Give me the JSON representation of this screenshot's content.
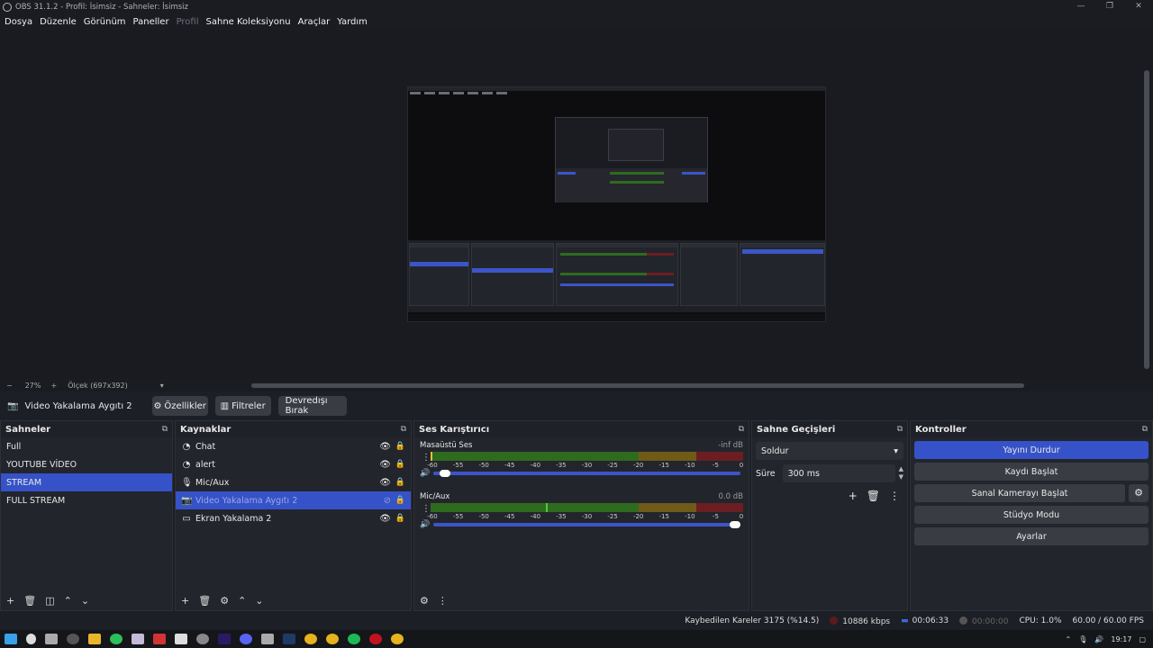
{
  "window": {
    "title": "OBS 31.1.2 - Profil: İsimsiz - Sahneler: İsimsiz"
  },
  "menu": {
    "items": [
      "Dosya",
      "Düzenle",
      "Görünüm",
      "Paneller",
      "Profil",
      "Sahne Koleksiyonu",
      "Araçlar",
      "Yardım"
    ],
    "disabled": [
      "Profil"
    ]
  },
  "zoom": {
    "minus": "−",
    "percent": "27%",
    "plus": "+",
    "scale": "Ölçek (697x392)",
    "dropdown": "▾"
  },
  "source_bar": {
    "name": "Video Yakalama Aygıtı 2",
    "properties": "Özellikler",
    "filters": "Filtreler",
    "deactivate": "Devredışı Bırak"
  },
  "scenes": {
    "title": "Sahneler",
    "items": [
      "Full",
      "YOUTUBE VİDEO",
      "STREAM",
      "FULL STREAM"
    ],
    "selected": 2
  },
  "sources": {
    "title": "Kaynaklar",
    "items": [
      {
        "name": "Chat",
        "icon": "globe-icon"
      },
      {
        "name": "alert",
        "icon": "globe-icon"
      },
      {
        "name": "Mic/Aux",
        "icon": "mic-icon"
      },
      {
        "name": "Video Yakalama Aygıtı 2",
        "icon": "camera-icon"
      },
      {
        "name": "Ekran Yakalama 2",
        "icon": "monitor-icon"
      }
    ],
    "selected": 3
  },
  "mixer": {
    "title": "Ses Karıştırıcı",
    "channels": [
      {
        "name": "Masaüstü Ses",
        "db": "-inf dB",
        "level": 0.0,
        "volume": 0.02
      },
      {
        "name": "Mic/Aux",
        "db": "0.0 dB",
        "level": 0.37,
        "volume": 1.0
      }
    ],
    "ticks": [
      "-60",
      "-55",
      "-50",
      "-45",
      "-40",
      "-35",
      "-30",
      "-25",
      "-20",
      "-15",
      "-10",
      "-5",
      "0"
    ]
  },
  "transitions": {
    "title": "Sahne Geçişleri",
    "selected": "Soldur",
    "duration_label": "Süre",
    "duration_value": "300 ms"
  },
  "controls": {
    "title": "Kontroller",
    "stop_stream": "Yayını Durdur",
    "start_record": "Kaydı Başlat",
    "virtual_cam": "Sanal Kamerayı Başlat",
    "studio_mode": "Stüdyo Modu",
    "settings": "Ayarlar"
  },
  "status": {
    "dropped": "Kaybedilen Kareler 3175 (%14.5)",
    "bitrate": "10886 kbps",
    "stream_time": "00:06:33",
    "rec_time": "00:00:00",
    "cpu": "CPU: 1.0%",
    "fps": "60.00 / 60.00 FPS"
  },
  "taskbar": {
    "time": "19:17"
  },
  "colors": {
    "accent": "#3652c8",
    "meter_green": "#2f6b1e",
    "meter_yellow": "#6f5a18",
    "meter_red": "#6b1e22",
    "background": "#1d1f26"
  }
}
